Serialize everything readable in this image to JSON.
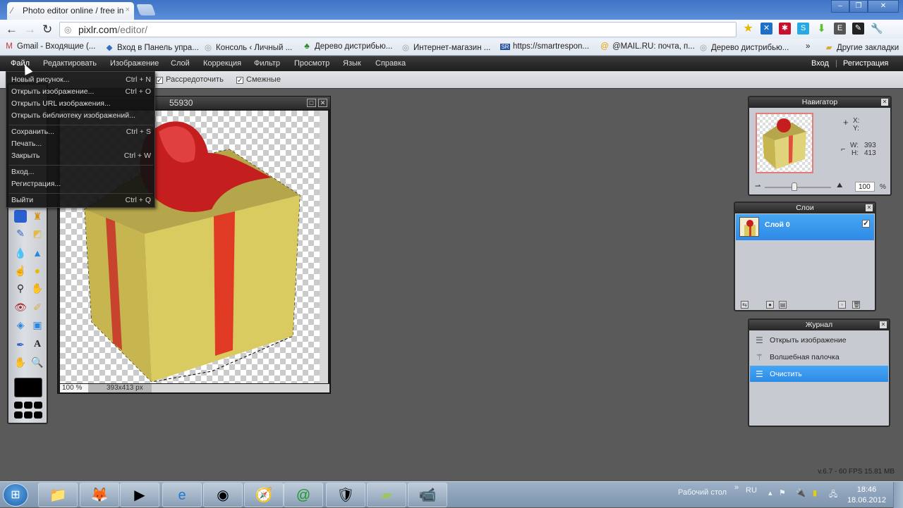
{
  "browser": {
    "tab_title": "Photo editor online / free in",
    "tab_icon": "brush-icon",
    "url_domain": "pixlr.com",
    "url_path": "/editor/",
    "window_controls": [
      "minimize",
      "restore",
      "close"
    ],
    "extensions": [
      "star-icon",
      "x-extension-icon",
      "red-star-extension-icon",
      "skype-icon",
      "download-arrow-icon",
      "evernote-icon",
      "pen-extension-icon",
      "wrench-icon"
    ],
    "bookmarks": [
      {
        "label": "Gmail - Входящие (...",
        "icon": "gmail-icon"
      },
      {
        "label": "Вход в Панель упра...",
        "icon": "diamond-icon"
      },
      {
        "label": "Консоль ‹ Личный ...",
        "icon": "globe-icon"
      },
      {
        "label": "Дерево дистрибью...",
        "icon": "tree-icon"
      },
      {
        "label": "Интернет-магазин ...",
        "icon": "globe-icon"
      },
      {
        "label": "https://smartrespon...",
        "icon": "sr-icon"
      },
      {
        "label": "@MAIL.RU: почта, п...",
        "icon": "mailru-icon"
      },
      {
        "label": "Дерево дистрибью...",
        "icon": "globe-icon"
      }
    ],
    "bookmarks_overflow": "»",
    "other_bookmarks": "Другие закладки"
  },
  "app": {
    "menu": [
      "Файл",
      "Редактировать",
      "Изображение",
      "Слой",
      "Коррекция",
      "Фильтр",
      "Просмотр",
      "Язык",
      "Справка"
    ],
    "login": "Вход",
    "separator": "|",
    "register": "Регистрация",
    "options": {
      "scatter_label": "Рассредоточить",
      "scatter_checked": true,
      "contiguous_label": "Смежные",
      "contiguous_checked": true
    },
    "file_menu": [
      {
        "label": "Новый рисунок...",
        "shortcut": "Ctrl + N"
      },
      {
        "label": "Открыть изображение...",
        "shortcut": "Ctrl + O"
      },
      {
        "label": "Открыть URL изображения...",
        "shortcut": ""
      },
      {
        "label": "Открыть библиотеку изображений...",
        "shortcut": ""
      },
      {
        "label": "Сохранить...",
        "shortcut": "Ctrl + S"
      },
      {
        "label": "Печать...",
        "shortcut": ""
      },
      {
        "label": "Закрыть",
        "shortcut": "Ctrl + W"
      },
      {
        "label": "Вход...",
        "shortcut": ""
      },
      {
        "label": "Регистрация...",
        "shortcut": ""
      },
      {
        "label": "Выйти",
        "shortcut": "Ctrl + Q"
      }
    ],
    "document": {
      "title": "55930",
      "zoom": "100 %",
      "dimensions": "393x413 px"
    },
    "navigator": {
      "title": "Навигатор",
      "x_label": "X:",
      "y_label": "Y:",
      "x_value": "",
      "y_value": "",
      "w_label": "W:",
      "w_value": "393",
      "h_label": "H:",
      "h_value": "413",
      "zoom_value": "100",
      "zoom_unit": "%",
      "slider_fraction": 0.45
    },
    "layers": {
      "title": "Слои",
      "items": [
        {
          "name": "Слой 0",
          "visible": true,
          "selected": true
        }
      ]
    },
    "history": {
      "title": "Журнал",
      "items": [
        {
          "label": "Открыть изображение",
          "icon": "document-icon",
          "active": false
        },
        {
          "label": "Волшебная палочка",
          "icon": "magic-wand-icon",
          "active": false
        },
        {
          "label": "Очистить",
          "icon": "document-icon",
          "active": true
        }
      ]
    },
    "status_line": "v.6.7 - 60 FPS 15.81 MB",
    "colors": {
      "selection_blue": "#2e8ae6",
      "foreground_color": "#000000"
    }
  },
  "taskbar": {
    "apps": [
      "windows-explorer-icon",
      "firefox-icon",
      "media-player-icon",
      "internet-explorer-icon",
      "chrome-icon",
      "safari-icon",
      "mail-agent-icon",
      "security-shield-icon",
      "notes-icon",
      "camcorder-icon"
    ],
    "desktop_label": "Рабочий стол",
    "overflow": "»",
    "language": "RU",
    "time": "18:46",
    "date": "18.06.2012"
  }
}
